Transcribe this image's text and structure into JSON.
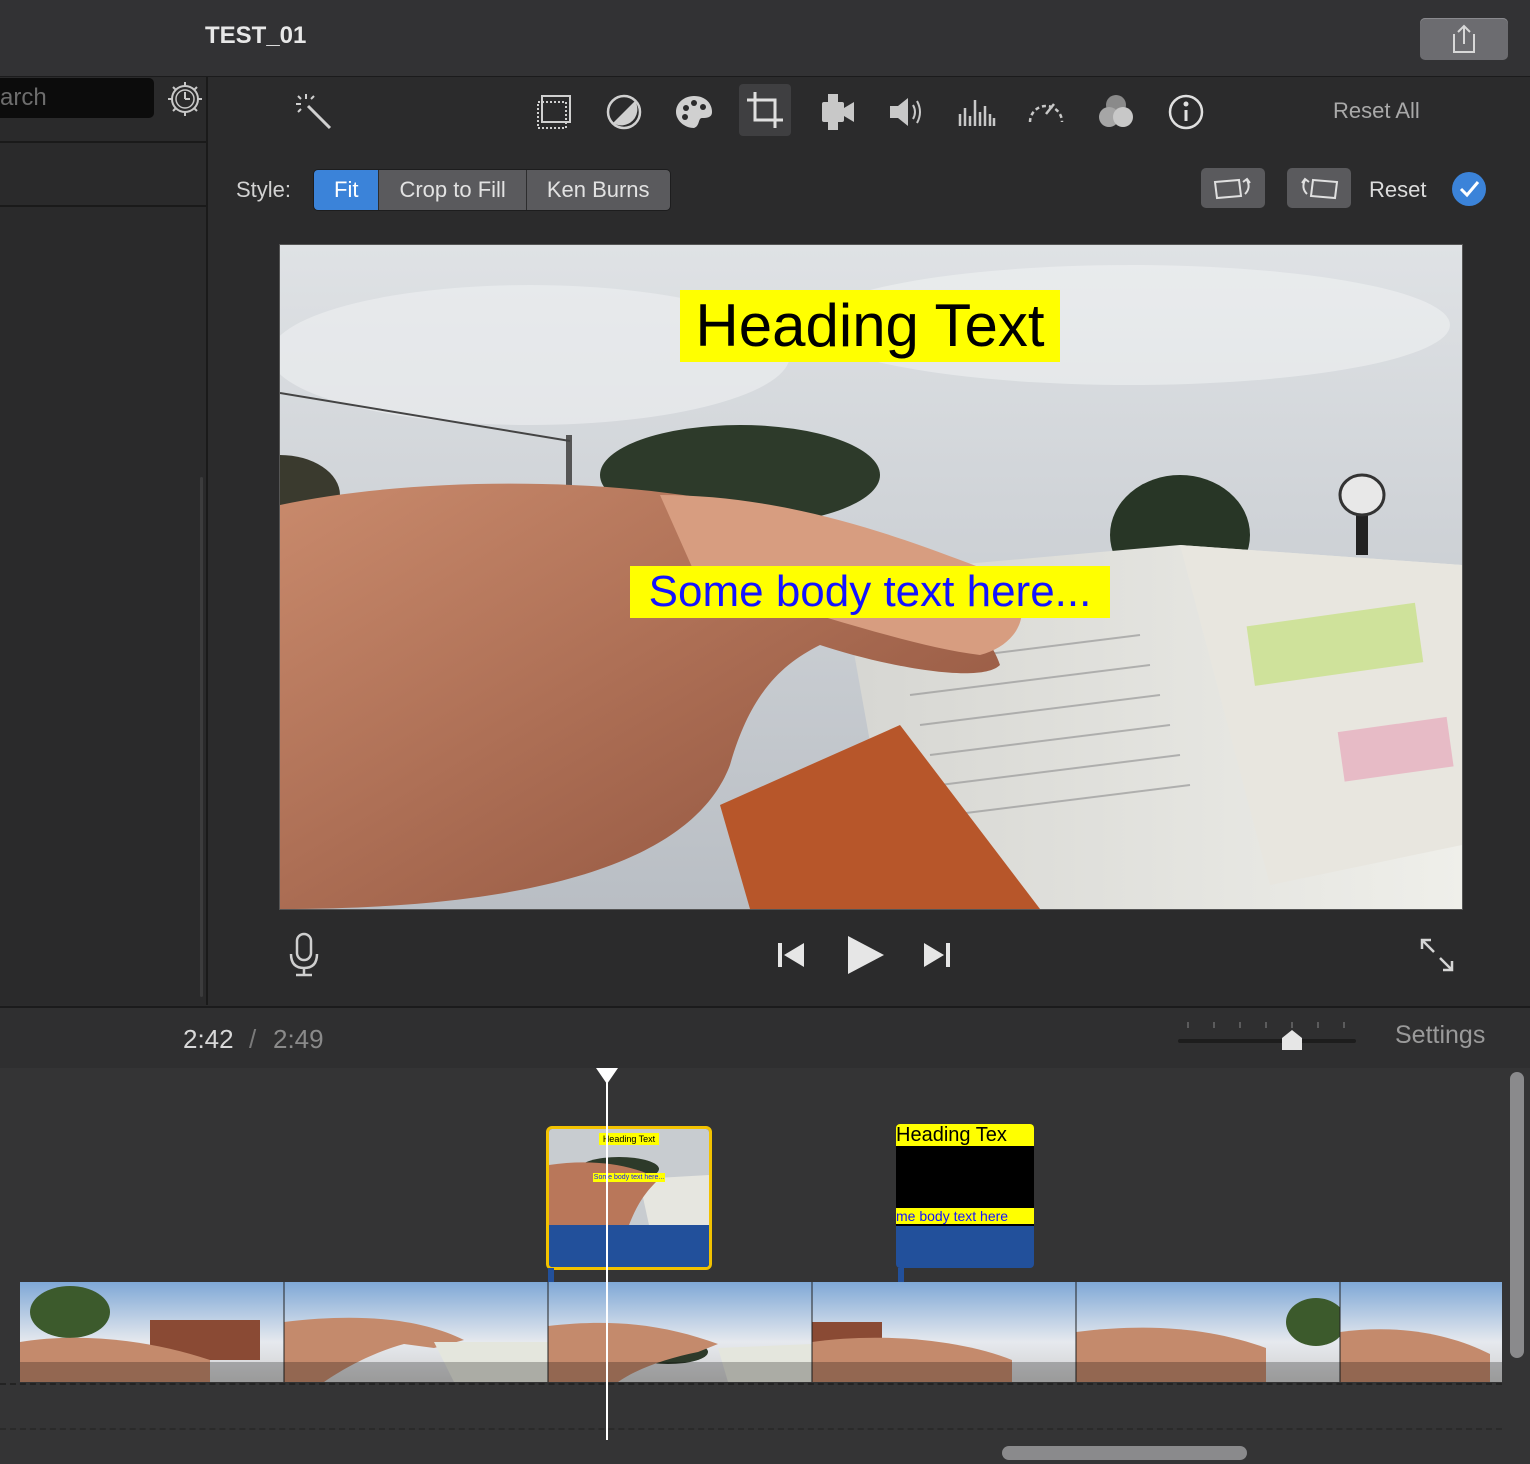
{
  "window": {
    "title": "TEST_01"
  },
  "sidebar": {
    "search_placeholder": "arch"
  },
  "toolbar": {
    "tools": [
      {
        "name": "magic-wand-icon"
      },
      {
        "name": "color-balance-icon"
      },
      {
        "name": "color-correction-icon"
      },
      {
        "name": "color-palette-icon"
      },
      {
        "name": "crop-icon",
        "active": true
      },
      {
        "name": "stabilization-icon"
      },
      {
        "name": "volume-icon"
      },
      {
        "name": "noise-reduction-icon"
      },
      {
        "name": "speed-icon"
      },
      {
        "name": "clip-filter-icon"
      },
      {
        "name": "info-icon"
      }
    ],
    "reset_all": "Reset All"
  },
  "crop": {
    "style_label": "Style:",
    "styles": [
      "Fit",
      "Crop to Fill",
      "Ken Burns"
    ],
    "selected_style": "Fit",
    "reset_label": "Reset"
  },
  "preview": {
    "heading_text": "Heading Text",
    "body_text": "Some body text here..."
  },
  "timeline": {
    "current_time": "2:42",
    "separator": "/",
    "total_time": "2:49",
    "settings_label": "Settings",
    "clip1_heading": "Heading Text",
    "clip1_body": "Some body text here...",
    "clip2_heading": "Heading Tex",
    "clip2_body": "me body text here"
  },
  "colors": {
    "accent": "#3b83d9",
    "overlay_highlight": "#ffff00",
    "body_text_color": "#1414ff",
    "clip_bar": "#22509b",
    "selection": "#f2c200"
  }
}
